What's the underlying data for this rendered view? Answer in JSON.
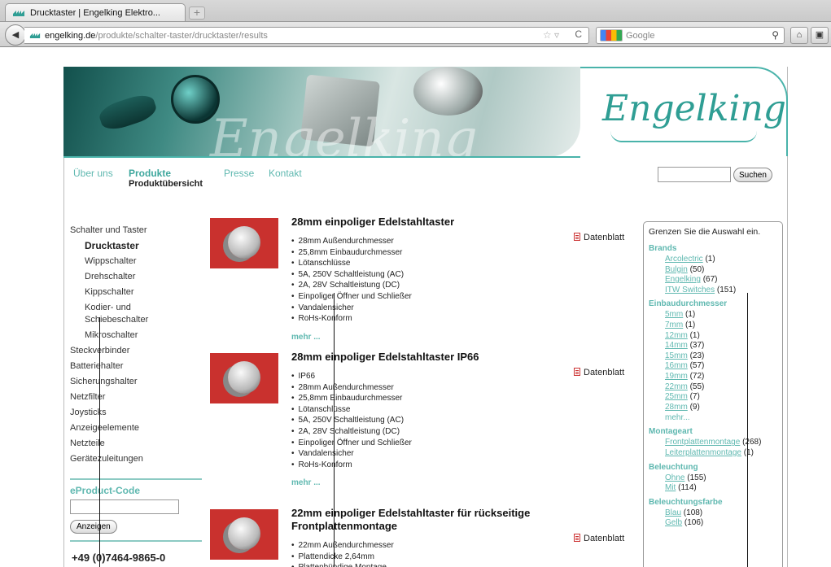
{
  "browser": {
    "tab_title": "Drucktaster | Engelking Elektro...",
    "new_tab": "+",
    "url_host": "engelking.de",
    "url_path": "/produkte/schalter-taster/drucktaster/results",
    "search_placeholder": "Google"
  },
  "header": {
    "banner_word": "Engelking",
    "logo": "Engelking"
  },
  "nav": {
    "items": [
      "Über uns",
      "Produkte",
      "Presse",
      "Kontakt"
    ],
    "sub": "Produktübersicht",
    "search_button": "Suchen"
  },
  "sidebar": {
    "items": [
      {
        "label": "Schalter und Taster",
        "level": 0
      },
      {
        "label": "Drucktaster",
        "level": 1,
        "active": true
      },
      {
        "label": "Wippschalter",
        "level": 1
      },
      {
        "label": "Drehschalter",
        "level": 1
      },
      {
        "label": "Kippschalter",
        "level": 1
      },
      {
        "label": "Kodier- und Schiebeschalter",
        "level": 1,
        "two": true
      },
      {
        "label": "Mikroschalter",
        "level": 1
      },
      {
        "label": "Steckverbinder",
        "level": 0
      },
      {
        "label": "Batteriehalter",
        "level": 0
      },
      {
        "label": "Sicherungshalter",
        "level": 0
      },
      {
        "label": "Netzfilter",
        "level": 0
      },
      {
        "label": "Joysticks",
        "level": 0
      },
      {
        "label": "Anzeigeelemente",
        "level": 0
      },
      {
        "label": "Netzteile",
        "level": 0
      },
      {
        "label": "Gerätezuleitungen",
        "level": 0
      }
    ],
    "ecode_title": "eProduct-Code",
    "ecode_button": "Anzeigen",
    "phone": "+49 (0)7464-9865-0"
  },
  "products": [
    {
      "title": "28mm einpoliger Edelstahltaster",
      "features": [
        "28mm Außendurchmesser",
        "25,8mm Einbaudurchmesser",
        "Lötanschlüsse",
        "5A, 250V Schaltleistung (AC)",
        "2A, 28V Schaltleistung (DC)",
        "Einpoliger Öffner und Schließer",
        "Vandalensicher",
        "RoHs-Konform"
      ],
      "more": "mehr ...",
      "datasheet": "Datenblatt"
    },
    {
      "title": "28mm einpoliger Edelstahltaster IP66",
      "features": [
        "IP66",
        "28mm Außendurchmesser",
        "25,8mm Einbaudurchmesser",
        "Lötanschlüsse",
        "5A, 250V Schaltleistung (AC)",
        "2A, 28V Schaltleistung (DC)",
        "Einpoliger Öffner und Schließer",
        "Vandalensicher",
        "RoHs-Konform"
      ],
      "more": "mehr ...",
      "datasheet": "Datenblatt"
    },
    {
      "title": "22mm einpoliger Edelstahltaster für rückseitige Frontplattenmontage",
      "features": [
        "22mm Außendurchmesser",
        "Plattendicke 2,64mm",
        "Plattenbündige Montage"
      ],
      "more": "",
      "datasheet": "Datenblatt"
    }
  ],
  "filter": {
    "header": "Grenzen Sie die Auswahl ein.",
    "sections": [
      {
        "title": "Brands",
        "items": [
          {
            "label": "Arcolectric",
            "count": "(1)"
          },
          {
            "label": "Bulgin",
            "count": "(50)"
          },
          {
            "label": "Engelking",
            "count": "(67)"
          },
          {
            "label": "ITW Switches",
            "count": "(151)"
          }
        ]
      },
      {
        "title": "Einbaudurchmesser",
        "items": [
          {
            "label": "5mm",
            "count": "(1)"
          },
          {
            "label": "7mm",
            "count": "(1)"
          },
          {
            "label": "12mm",
            "count": "(1)"
          },
          {
            "label": "14mm",
            "count": "(37)"
          },
          {
            "label": "15mm",
            "count": "(23)"
          },
          {
            "label": "16mm",
            "count": "(57)"
          },
          {
            "label": "19mm",
            "count": "(72)"
          },
          {
            "label": "22mm",
            "count": "(55)"
          },
          {
            "label": "25mm",
            "count": "(7)"
          },
          {
            "label": "28mm",
            "count": "(9)"
          }
        ],
        "more": "mehr..."
      },
      {
        "title": "Montageart",
        "items": [
          {
            "label": "Frontplattenmontage",
            "count": "(268)"
          },
          {
            "label": "Leiterplattenmontage",
            "count": "(1)"
          }
        ]
      },
      {
        "title": "Beleuchtung",
        "items": [
          {
            "label": "Ohne",
            "count": "(155)"
          },
          {
            "label": "Mit",
            "count": "(114)"
          }
        ]
      },
      {
        "title": "Beleuchtungsfarbe",
        "items": [
          {
            "label": "Blau",
            "count": "(108)"
          },
          {
            "label": "Gelb",
            "count": "(106)"
          }
        ]
      }
    ]
  }
}
